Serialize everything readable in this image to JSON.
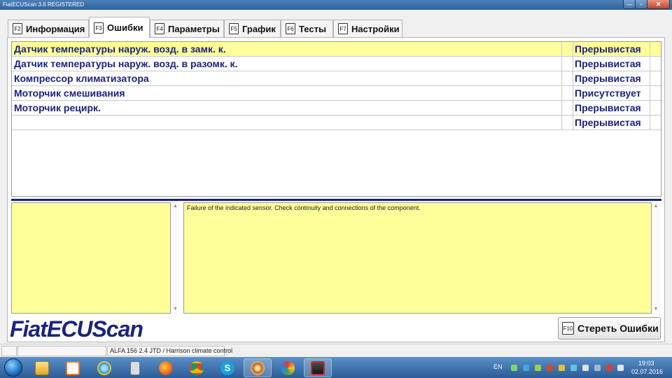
{
  "window": {
    "title": "FiatECUScan 3.6 REGISTERED",
    "minimize": "—",
    "maximize": "▫",
    "close": "✕"
  },
  "tabs": [
    {
      "key": "F2",
      "label": "Информация"
    },
    {
      "key": "F3",
      "label": "Ошибки"
    },
    {
      "key": "F4",
      "label": "Параметры"
    },
    {
      "key": "F5",
      "label": "График"
    },
    {
      "key": "F6",
      "label": "Тесты"
    },
    {
      "key": "F7",
      "label": "Настройки"
    }
  ],
  "errors": [
    {
      "name": "Датчик температуры наруж. возд. в замк. к.",
      "status": "Прерывистая"
    },
    {
      "name": "Датчик температуры наруж. возд. в разомк. к.",
      "status": "Прерывистая"
    },
    {
      "name": "Компрессор климатизатора",
      "status": "Прерывистая"
    },
    {
      "name": "Моторчик смешивания",
      "status": "Присутствует"
    },
    {
      "name": "Моторчик рецирк.",
      "status": "Прерывистая"
    },
    {
      "name": "",
      "status": "Прерывистая"
    }
  ],
  "description": "Failure of the indicated sensor. Check continuity and connections of the component.",
  "logo": "FiatECUScan",
  "clear_button": {
    "key": "F10",
    "label": "Стереть Ошибки"
  },
  "statusbar": {
    "vehicle": "ALFA 156 2.4 JTD / Harrison climate control"
  },
  "taskbar": {
    "language": "EN",
    "time": "19:03",
    "date": "02.07.2016"
  },
  "colors": {
    "highlight": "#ffff99",
    "text_dark_blue": "#1a237e",
    "taskbar": "#2b5c96"
  }
}
